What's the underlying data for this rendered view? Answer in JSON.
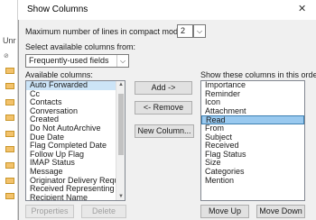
{
  "background_app": {
    "partial_label": "Unr"
  },
  "dialog": {
    "title": "Show Columns",
    "close_glyph": "✕",
    "max_lines_label": "Maximum number of lines in compact mode:",
    "max_lines_value": "2",
    "select_from_label": "Select available columns from:",
    "select_from_value": "Frequently-used fields",
    "available_label": "Available columns:",
    "show_label": "Show these columns in this order:",
    "available_columns": [
      "Auto Forwarded",
      "Cc",
      "Contacts",
      "Conversation",
      "Created",
      "Do Not AutoArchive",
      "Due Date",
      "Flag Completed Date",
      "Follow Up Flag",
      "IMAP Status",
      "Message",
      "Originator Delivery Reques",
      "Received Representing Na",
      "Recipient Name"
    ],
    "available_selected_index": 0,
    "shown_columns": [
      "Importance",
      "Reminder",
      "Icon",
      "Attachment",
      "Read",
      "From",
      "Subject",
      "Received",
      "Flag Status",
      "Size",
      "Categories",
      "Mention"
    ],
    "shown_selected_index": 4,
    "buttons": {
      "add": "Add ->",
      "remove": "<- Remove",
      "new_column": "New Column...",
      "properties": "Properties",
      "delete": "Delete",
      "move_up": "Move Up",
      "move_down": "Move Down"
    }
  }
}
